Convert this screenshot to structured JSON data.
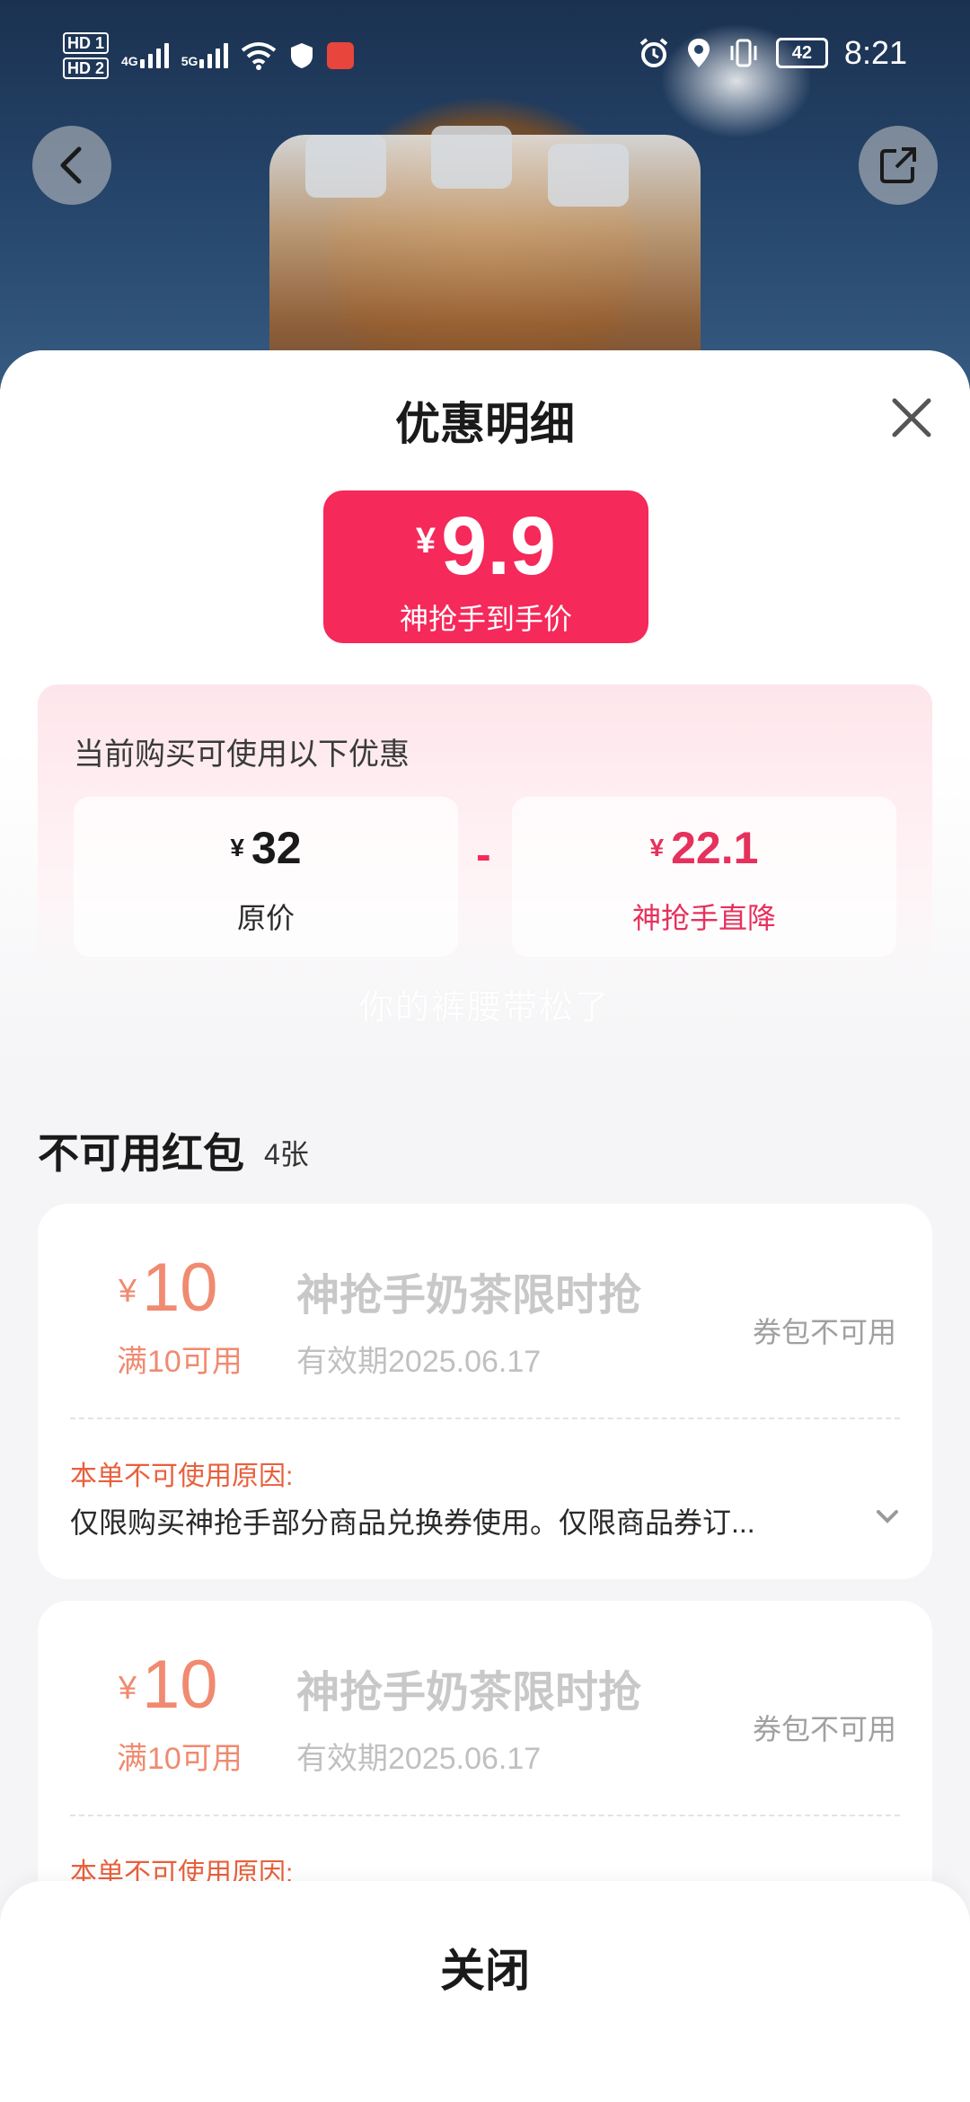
{
  "status_bar": {
    "hd1": "HD 1",
    "hd2": "HD 2",
    "net1": "4G",
    "net2": "5G",
    "battery": "42",
    "time": "8:21"
  },
  "header": {
    "back_icon": "chevron-left-icon",
    "share_icon": "share-icon"
  },
  "sheet": {
    "title": "优惠明细",
    "close_icon": "close-icon",
    "price": {
      "currency": "¥",
      "value": "9.9",
      "label": "神抢手到手价"
    },
    "promo": {
      "heading": "当前购买可使用以下优惠",
      "original": {
        "currency": "¥",
        "value": "32",
        "label": "原价"
      },
      "operator": "-",
      "discount": {
        "currency": "¥",
        "value": "22.1",
        "label": "神抢手直降"
      }
    },
    "watermark": "你的裤腰带松了",
    "unusable": {
      "title": "不可用红包",
      "count": "4张",
      "coupons": [
        {
          "currency": "¥",
          "amount": "10",
          "condition": "满10可用",
          "title": "神抢手奶茶限时抢",
          "validity": "有效期2025.06.17",
          "state": "券包不可用",
          "reason_label": "本单不可使用原因:",
          "reason": "仅限购买神抢手部分商品兑换券使用。仅限商品券订..."
        },
        {
          "currency": "¥",
          "amount": "10",
          "condition": "满10可用",
          "title": "神抢手奶茶限时抢",
          "validity": "有效期2025.06.17",
          "state": "券包不可用",
          "reason_label": "本单不可使用原因:"
        }
      ]
    },
    "close_button": "关闭"
  },
  "colors": {
    "accent": "#f5295a",
    "coupon_amount": "#f08a70",
    "reason_label": "#e8603c"
  }
}
